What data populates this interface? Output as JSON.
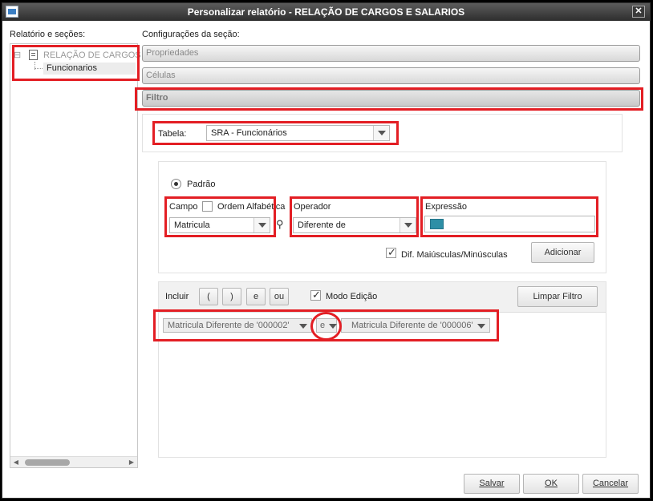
{
  "window": {
    "title": "Personalizar relatório - RELAÇÃO DE CARGOS E SALARIOS",
    "close_label": "✕"
  },
  "left": {
    "label": "Relatório e seções:",
    "tree": [
      {
        "label": "RELAÇÃO DE CARGOS",
        "expander": "⊟"
      },
      {
        "label": "Funcionarios"
      }
    ]
  },
  "config_label": "Configurações da seção:",
  "sections": [
    "Propriedades",
    "Células",
    "Filtro"
  ],
  "filter": {
    "table_label": "Tabela:",
    "table_value": "SRA - Funcionários",
    "mode_label": "Padrão",
    "campo_label": "Campo",
    "ordem_label": "Ordem Alfabética",
    "campo_value": "Matricula",
    "operador_label": "Operador",
    "operador_value": "Diferente de",
    "expressao_label": "Expressão",
    "case_label": "Dif. Maiúsculas/Minúsculas",
    "add_button": "Adicionar",
    "incluir_label": "Incluir",
    "op_buttons": [
      "(",
      ")",
      "e",
      "ou"
    ],
    "modo_edicao_label": "Modo Edição",
    "limpar_button": "Limpar Filtro",
    "expr1": "Matricula Diferente de '000002'",
    "connector": "e",
    "expr2": "Matricula Diferente de '000006'"
  },
  "footer": {
    "save": "Salvar",
    "ok": "OK",
    "cancel": "Cancelar"
  },
  "colors": {
    "annotation": "#e31e24",
    "swatch": "#2e8fa6"
  }
}
